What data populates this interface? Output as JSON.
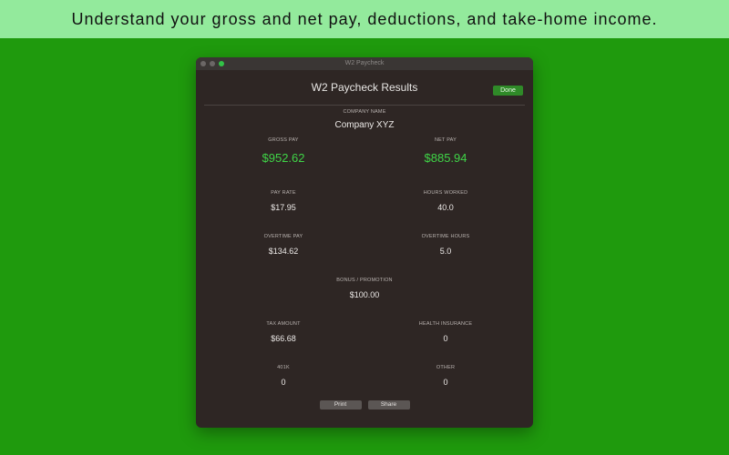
{
  "banner": {
    "text": "Understand your gross and net pay, deductions, and take-home income."
  },
  "window": {
    "title": "W2 Paycheck",
    "heading": "W2 Paycheck Results",
    "done_label": "Done"
  },
  "company": {
    "label": "COMPANY NAME",
    "value": "Company XYZ"
  },
  "gross_pay": {
    "label": "GROSS PAY",
    "value": "$952.62"
  },
  "net_pay": {
    "label": "NET PAY",
    "value": "$885.94"
  },
  "pay_rate": {
    "label": "PAY RATE",
    "value": "$17.95"
  },
  "hours_worked": {
    "label": "HOURS WORKED",
    "value": "40.0"
  },
  "overtime_pay": {
    "label": "OVERTIME PAY",
    "value": "$134.62"
  },
  "overtime_hours": {
    "label": "OVERTIME HOURS",
    "value": "5.0"
  },
  "bonus": {
    "label": "BONUS / PROMOTION",
    "value": "$100.00"
  },
  "tax_amount": {
    "label": "TAX AMOUNT",
    "value": "$66.68"
  },
  "health_insurance": {
    "label": "HEALTH INSURANCE",
    "value": "0"
  },
  "k401": {
    "label": "401K",
    "value": "0"
  },
  "other": {
    "label": "OTHER",
    "value": "0"
  },
  "actions": {
    "print_label": "Print",
    "share_label": "Share"
  },
  "colors": {
    "background": "#1f9a0d",
    "banner": "#93ea9c",
    "window": "#2e2624",
    "accent_green": "#3fd447",
    "done_button": "#2f8a28"
  }
}
